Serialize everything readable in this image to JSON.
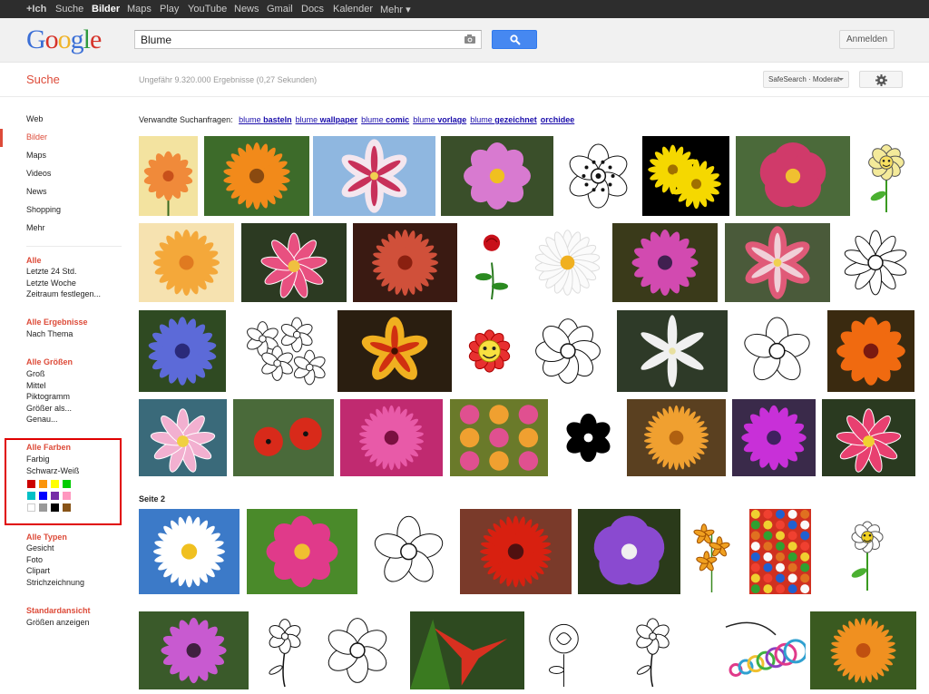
{
  "topbar": {
    "items": [
      "+Ich",
      "Suche",
      "Bilder",
      "Maps",
      "Play",
      "YouTube",
      "News",
      "Gmail",
      "Docs",
      "Kalender",
      "Mehr ▾"
    ]
  },
  "logo": {
    "letters": [
      "G",
      "o",
      "o",
      "g",
      "l",
      "e"
    ],
    "colors": [
      "#3b6fd6",
      "#d6332a",
      "#f0b429",
      "#3b6fd6",
      "#2f9a3f",
      "#d6332a"
    ]
  },
  "search": {
    "value": "Blume",
    "placeholder": ""
  },
  "header": {
    "login_label": "Anmelden"
  },
  "subheader": {
    "title": "Suche",
    "stats": "Ungefähr 9.320.000 Ergebnisse (0,27 Sekunden)",
    "safesearch_label": "SafeSearch · Moderat"
  },
  "nav": {
    "items": [
      "Web",
      "Bilder",
      "Maps",
      "Videos",
      "News",
      "Shopping",
      "Mehr"
    ],
    "active": "Bilder"
  },
  "filters": {
    "time_head": "Alle",
    "time_items": [
      "Letzte 24 Std.",
      "Letzte Woche",
      "Zeitraum festlegen..."
    ],
    "results_head": "Alle Ergebnisse",
    "results_items": [
      "Nach Thema"
    ],
    "size_head": "Alle Größen",
    "size_items": [
      "Groß",
      "Mittel",
      "Piktogramm",
      "Größer als...",
      "Genau..."
    ],
    "color_head": "Alle Farben",
    "color_items": [
      "Farbig",
      "Schwarz-Weiß"
    ],
    "swatch_colors": [
      "#cc0000",
      "#fb940b",
      "#ffff00",
      "#00cc00",
      "#03c0c6",
      "#0000ff",
      "#762ca7",
      "#ff98bf",
      "#ffffff",
      "#999999",
      "#000000",
      "#885418"
    ],
    "type_head": "Alle Typen",
    "type_items": [
      "Gesicht",
      "Foto",
      "Clipart",
      "Strichzeichnung"
    ],
    "view_head": "Standardansicht",
    "view_items": [
      "Größen anzeigen"
    ]
  },
  "related": {
    "label": "Verwandte Suchanfragen:",
    "links": [
      {
        "pre": "blume ",
        "bold": "basteln"
      },
      {
        "pre": "blume ",
        "bold": "wallpaper"
      },
      {
        "pre": "blume ",
        "bold": "comic"
      },
      {
        "pre": "blume ",
        "bold": "vorlage"
      },
      {
        "pre": "blume ",
        "bold": "gezeichnet"
      },
      {
        "pre": "",
        "bold": "orchidee"
      }
    ]
  },
  "page2_label": "Seite 2",
  "thumbnails": [
    {
      "kind": "flower",
      "bg": "#f3e3a0",
      "petal": "#f08a3a",
      "center": "#c8501a",
      "petals": 14,
      "stem": true
    },
    {
      "kind": "flower",
      "bg": "#3d6b2a",
      "petal": "#f28a1a",
      "center": "#8a4a10",
      "petals": 22
    },
    {
      "kind": "lily",
      "bg": "#8fb7e0",
      "petal": "#f4e6ee",
      "accent": "#c8305a"
    },
    {
      "kind": "flower",
      "bg": "#3a4f2a",
      "petal": "#d87ad0",
      "center": "#f0c020",
      "petals": 8
    },
    {
      "kind": "outline",
      "bg": "#ffffff",
      "petals": 6,
      "dots": true
    },
    {
      "kind": "double",
      "bg": "#000000",
      "petal": "#f5d800",
      "center": "#a07000"
    },
    {
      "kind": "flower",
      "bg": "#4b6a3a",
      "petal": "#d03a6a",
      "center": "#f0c030",
      "petals": 5
    },
    {
      "kind": "cartoon",
      "bg": "#ffffff",
      "petal": "#f4ea9a",
      "center": "#f8e060"
    },
    {
      "kind": "flower",
      "bg": "#f6e2b0",
      "petal": "#f4a83a",
      "center": "#e07a20",
      "petals": 20
    },
    {
      "kind": "lotus",
      "bg": "#2c3a22",
      "petal": "#e85080",
      "center": "#f0c040"
    },
    {
      "kind": "flower",
      "bg": "#3a1a12",
      "petal": "#d0503a",
      "center": "#8a2010",
      "petals": 24
    },
    {
      "kind": "rose",
      "bg": "#ffffff",
      "petal": "#c8101a"
    },
    {
      "kind": "flower",
      "bg": "#ffffff",
      "petal": "#fbfbfb",
      "center": "#f0b020",
      "petals": 18,
      "stroke": "#dddddd"
    },
    {
      "kind": "flower",
      "bg": "#3a3a1a",
      "petal": "#d24ab0",
      "center": "#402050",
      "petals": 16
    },
    {
      "kind": "lily",
      "bg": "#4a5a3a",
      "petal": "#e05a78",
      "accent": "#f0d0d8"
    },
    {
      "kind": "outline",
      "bg": "#ffffff",
      "petals": 10,
      "dots": false
    },
    {
      "kind": "flower",
      "bg": "#2f4a22",
      "petal": "#5c6ad8",
      "center": "#2a2a7a",
      "petals": 18
    },
    {
      "kind": "outline-multi",
      "bg": "#ffffff"
    },
    {
      "kind": "tulip",
      "bg": "#2a1e10",
      "petal": "#f0b020",
      "accent": "#d03010"
    },
    {
      "kind": "smiley",
      "bg": "#ffffff",
      "petal": "#e83030",
      "center": "#f8e040"
    },
    {
      "kind": "outline",
      "bg": "#ffffff",
      "petals": 8,
      "dots": false
    },
    {
      "kind": "star",
      "bg": "#2e3a28",
      "petal": "#f0f0f0",
      "center": "#e8e0a0"
    },
    {
      "kind": "outline",
      "bg": "#ffffff",
      "petals": 5,
      "dots": false
    },
    {
      "kind": "flower",
      "bg": "#3a2a10",
      "petal": "#f06a10",
      "center": "#7a1a10",
      "petals": 12
    },
    {
      "kind": "lotus",
      "bg": "#3a6a7a",
      "petal": "#f2b0d0",
      "center": "#f0d040"
    },
    {
      "kind": "poppy",
      "bg": "#4a6a3a",
      "petal": "#d82a1a"
    },
    {
      "kind": "flower",
      "bg": "#c02a70",
      "petal": "#e85aa8",
      "center": "#7a1040",
      "petals": 26
    },
    {
      "kind": "cluster",
      "bg": "#6a7a2a",
      "petal": "#f0a030",
      "accent": "#e05090"
    },
    {
      "kind": "outline-fill",
      "bg": "#ffffff",
      "petal": "#000000"
    },
    {
      "kind": "flower",
      "bg": "#5a4020",
      "petal": "#f0a030",
      "center": "#b06010",
      "petals": 30
    },
    {
      "kind": "flower",
      "bg": "#3a2a4a",
      "petal": "#c830d8",
      "center": "#402060",
      "petals": 16
    },
    {
      "kind": "lotus",
      "bg": "#2a3a20",
      "petal": "#e84070",
      "center": "#f0d030"
    },
    {
      "kind": "flower",
      "bg": "#3c7ac8",
      "petal": "#ffffff",
      "center": "#f0c020",
      "petals": 24
    },
    {
      "kind": "flower",
      "bg": "#4a8a2a",
      "petal": "#e03a8a",
      "center": "#f0c030",
      "petals": 8
    },
    {
      "kind": "outline",
      "bg": "#ffffff",
      "petals": 5,
      "dots": false
    },
    {
      "kind": "flower",
      "bg": "#7a3a2a",
      "petal": "#d82010",
      "center": "#501010",
      "petals": 28
    },
    {
      "kind": "flower",
      "bg": "#2a3a1a",
      "petal": "#8a4ad0",
      "center": "#f0f0f0",
      "petals": 5
    },
    {
      "kind": "lilies-drawn",
      "bg": "#ffffff",
      "petal": "#f0a020"
    },
    {
      "kind": "mosaic",
      "bg": "#d03020"
    },
    {
      "kind": "cartoon",
      "bg": "#ffffff",
      "petal": "#ffffff",
      "center": "#f0d020"
    },
    {
      "kind": "flower",
      "bg": "#3a5a2a",
      "petal": "#c85ad0",
      "center": "#402040",
      "petals": 16
    },
    {
      "kind": "outline-stem",
      "bg": "#ffffff"
    },
    {
      "kind": "outline",
      "bg": "#ffffff",
      "petals": 6,
      "dots": false
    },
    {
      "kind": "bird",
      "bg": "#2e4a20",
      "petal": "#d83020"
    },
    {
      "kind": "rose-drawn",
      "bg": "#ffffff"
    },
    {
      "kind": "outline-stem",
      "bg": "#ffffff"
    },
    {
      "kind": "swirl",
      "bg": "#ffffff"
    },
    {
      "kind": "flower",
      "bg": "#3a5a20",
      "petal": "#f09020",
      "center": "#c05010",
      "petals": 28
    }
  ]
}
